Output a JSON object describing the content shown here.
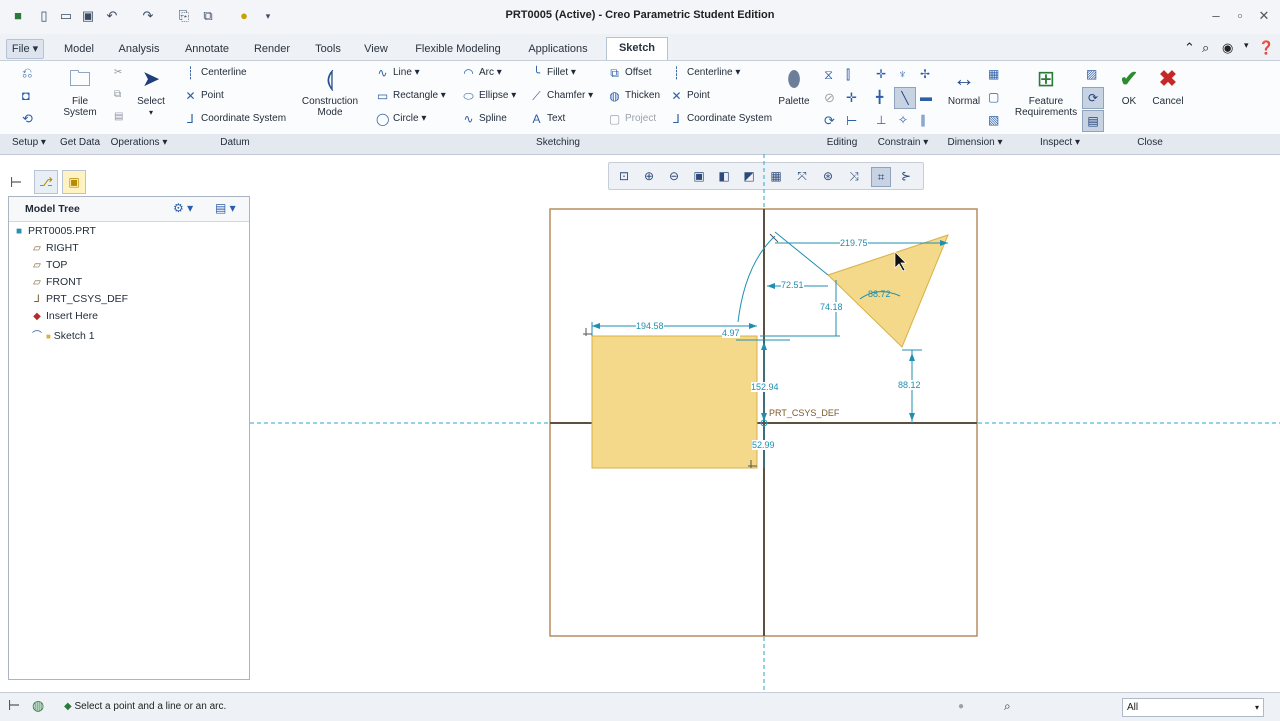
{
  "window": {
    "title": "PRT0005 (Active) - Creo Parametric Student Edition"
  },
  "tabs": [
    "File",
    "Model",
    "Analysis",
    "Annotate",
    "Render",
    "Tools",
    "View",
    "Flexible Modeling",
    "Applications",
    "Sketch"
  ],
  "ribbon": {
    "file_system": "File System",
    "select": "Select",
    "datum": {
      "centerline": "Centerline",
      "point": "Point",
      "coordinate_system": "Coordinate System"
    },
    "construction_mode": "Construction Mode",
    "sketching": {
      "line": "Line",
      "rectangle": "Rectangle",
      "circle": "Circle",
      "arc": "Arc",
      "ellipse": "Ellipse",
      "spline": "Spline",
      "fillet": "Fillet",
      "chamfer": "Chamfer",
      "text": "Text",
      "offset": "Offset",
      "thicken": "Thicken",
      "project": "Project",
      "centerline": "Centerline",
      "point": "Point",
      "coordinate_system": "Coordinate System",
      "palette": "Palette"
    },
    "normal": "Normal",
    "feature_requirements": "Feature Requirements",
    "ok": "OK",
    "cancel": "Cancel",
    "groups": {
      "setup": "Setup",
      "get_data": "Get Data",
      "operations": "Operations",
      "datum": "Datum",
      "sketching": "Sketching",
      "editing": "Editing",
      "constrain": "Constrain",
      "dimension": "Dimension",
      "inspect": "Inspect",
      "close": "Close"
    }
  },
  "model_tree": {
    "header": "Model Tree",
    "items": [
      {
        "label": "PRT0005.PRT",
        "icon": "part-icon"
      },
      {
        "label": "RIGHT",
        "icon": "datum-plane-icon"
      },
      {
        "label": "TOP",
        "icon": "datum-plane-icon"
      },
      {
        "label": "FRONT",
        "icon": "datum-plane-icon"
      },
      {
        "label": "PRT_CSYS_DEF",
        "icon": "csys-icon"
      },
      {
        "label": "Insert Here",
        "icon": "insert-arrow-icon"
      },
      {
        "label": "Sketch 1",
        "icon": "sketch-icon"
      }
    ]
  },
  "sketch": {
    "csys_label": "PRT_CSYS_DEF",
    "dimensions": {
      "rect_width": "194.58",
      "rect_offset": "4.97",
      "rect_height_top": "152.94",
      "rect_height_bottom": "52.99",
      "tri_top": "219.75",
      "tri_offset": "72.51",
      "tri_vert": "74.18",
      "tri_angle": "88.72",
      "tri_bottom": "88.12"
    },
    "colors": {
      "fill": "#f4d98a",
      "fill_stroke": "#d8b046",
      "dimension": "#1f8fb0",
      "centerline": "#2aa6c8",
      "frame": "#b58d62"
    }
  },
  "status": {
    "message": "Select a point and a line or an arc.",
    "filter": "All"
  }
}
